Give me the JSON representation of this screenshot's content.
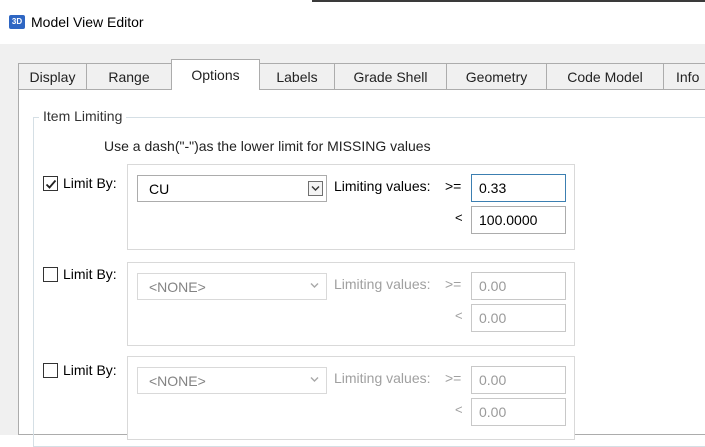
{
  "window": {
    "icon_text": "3D",
    "title": "Model View Editor"
  },
  "tabs": [
    {
      "label": "Display",
      "active": false
    },
    {
      "label": "Range",
      "active": false
    },
    {
      "label": "Options",
      "active": true
    },
    {
      "label": "Labels",
      "active": false
    },
    {
      "label": "Grade Shell",
      "active": false
    },
    {
      "label": "Geometry",
      "active": false
    },
    {
      "label": "Code Model",
      "active": false
    },
    {
      "label": "Info",
      "active": false
    }
  ],
  "item_limiting": {
    "group_label": "Item Limiting",
    "hint": "Use a dash(\"-\")as the lower limit for MISSING values",
    "rows": [
      {
        "checked": true,
        "label": "Limit By:",
        "field": "CU",
        "limiting_label": "Limiting values:",
        "gte_symbol": ">=",
        "lower": "0.33",
        "lt_symbol": "<",
        "upper": "100.0000",
        "enabled": true
      },
      {
        "checked": false,
        "label": "Limit By:",
        "field": "<NONE>",
        "limiting_label": "Limiting values:",
        "gte_symbol": ">=",
        "lower": "0.00",
        "lt_symbol": "<",
        "upper": "0.00",
        "enabled": false
      },
      {
        "checked": false,
        "label": "Limit By:",
        "field": "<NONE>",
        "limiting_label": "Limiting values:",
        "gte_symbol": ">=",
        "lower": "0.00",
        "lt_symbol": "<",
        "upper": "0.00",
        "enabled": false
      }
    ]
  },
  "colors": {
    "accent": "#2e66c3",
    "window_bg": "#f0f0f0",
    "focus_border": "#3c7fb1"
  }
}
